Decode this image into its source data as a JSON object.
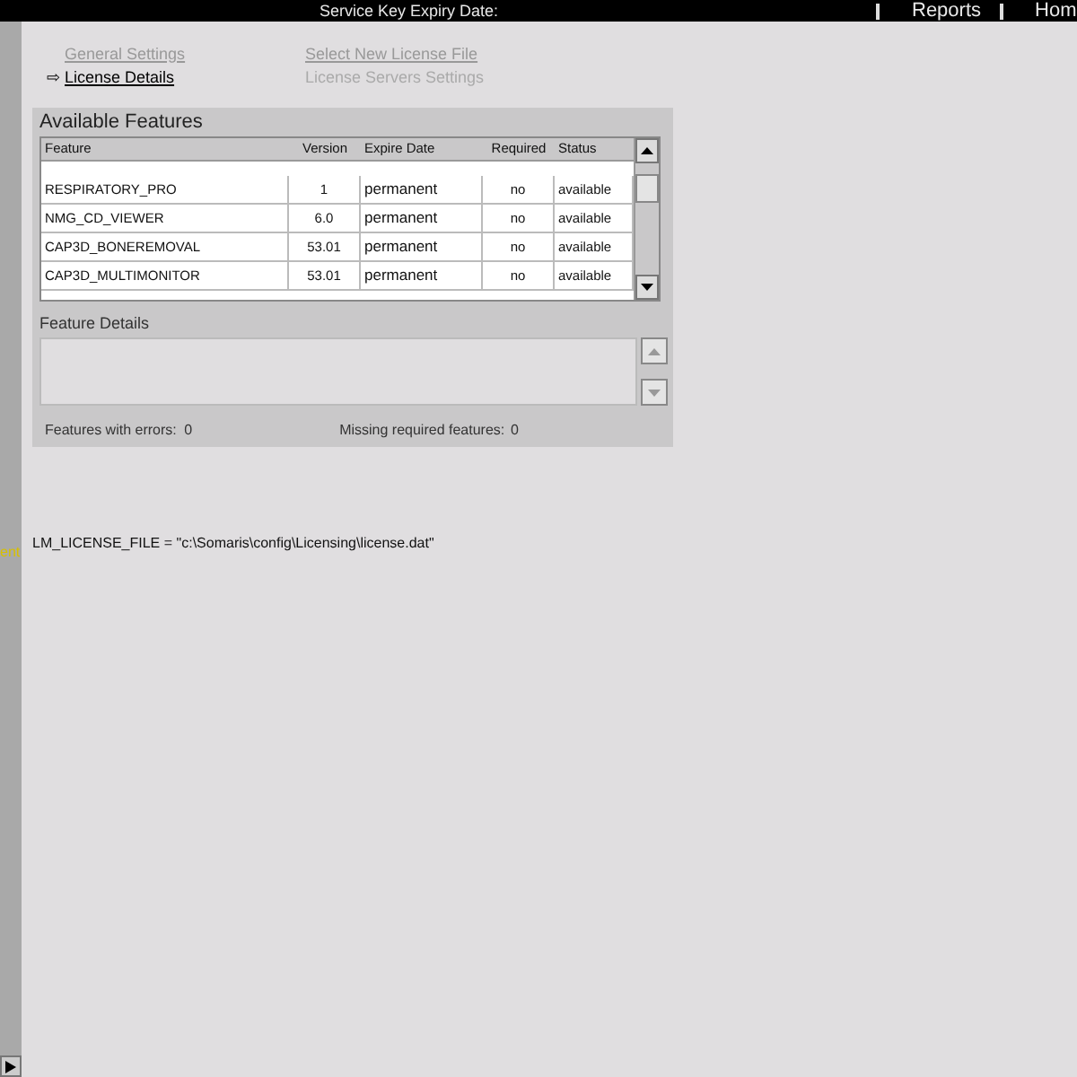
{
  "top_bar": {
    "title": "Service Key Expiry Date:",
    "links": [
      "Reports",
      "Hom"
    ]
  },
  "side_strip": {
    "label": "ent"
  },
  "nav": {
    "arrow": "⇨",
    "left": [
      {
        "label": "General Settings",
        "selected": false
      },
      {
        "label": "License Details",
        "selected": true
      }
    ],
    "right": [
      {
        "label": "Select New License File",
        "disabled": false
      },
      {
        "label": "License Servers Settings",
        "disabled": true
      }
    ]
  },
  "features_panel": {
    "title": "Available Features",
    "columns": [
      "Feature",
      "Version",
      "Expire Date",
      "Required",
      "Status"
    ],
    "rows": [
      {
        "cells": [
          "RESPIRATORY_PRO",
          "1",
          "permanent",
          "no",
          "available"
        ]
      },
      {
        "cells": [
          "NMG_CD_VIEWER",
          "6.0",
          "permanent",
          "no",
          "available"
        ]
      },
      {
        "cells": [
          "CAP3D_BONEREMOVAL",
          "53.01",
          "permanent",
          "no",
          "available"
        ]
      },
      {
        "cells": [
          "CAP3D_MULTIMONITOR",
          "53.01",
          "permanent",
          "no",
          "available"
        ]
      }
    ],
    "details_label": "Feature Details",
    "errors_label": "Features with errors:",
    "errors_value": "0",
    "missing_label": "Missing required features:",
    "missing_value": "0"
  },
  "license_file": "LM_LICENSE_FILE = \"c:\\Somaris\\config\\Licensing\\license.dat\""
}
